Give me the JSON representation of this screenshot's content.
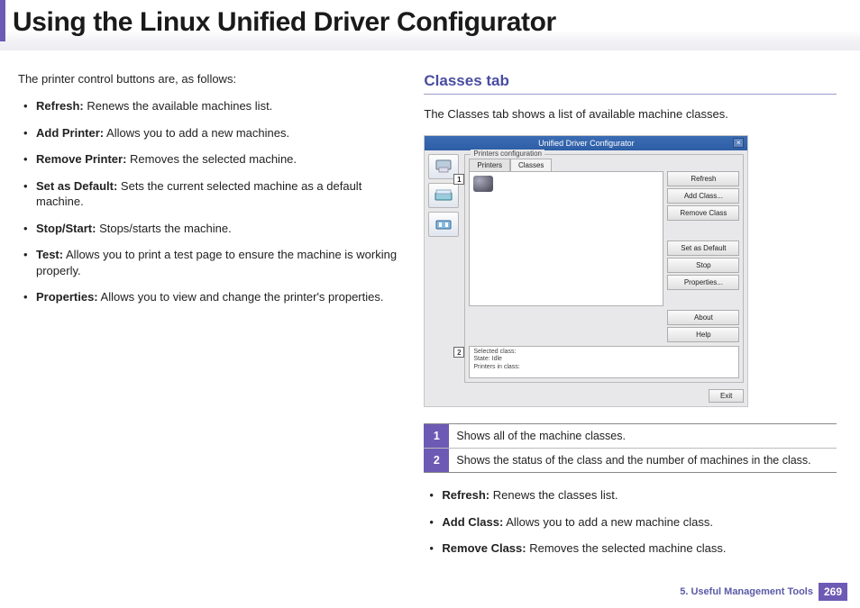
{
  "page_title": "Using the Linux Unified Driver Configurator",
  "left": {
    "intro": "The printer control buttons are, as follows:",
    "items": [
      {
        "term": "Refresh:",
        "text": " Renews the available machines list."
      },
      {
        "term": "Add Printer:",
        "text": " Allows you to add a new machines."
      },
      {
        "term": "Remove Printer:",
        "text": " Removes the selected machine."
      },
      {
        "term": "Set as Default:",
        "text": " Sets the current selected machine as a default machine."
      },
      {
        "term": "Stop/Start:",
        "text": " Stops/starts the machine."
      },
      {
        "term": "Test:",
        "text": " Allows you to print a test page to ensure the machine is working properly."
      },
      {
        "term": "Properties:",
        "text": " Allows you to view and change the printer's properties."
      }
    ]
  },
  "right": {
    "heading": "Classes tab",
    "desc": "The Classes tab shows a list of available machine classes.",
    "screenshot": {
      "title": "Unified Driver Configurator",
      "group_label": "Printers configuration",
      "tab_printers": "Printers",
      "tab_classes": "Classes",
      "buttons": {
        "refresh": "Refresh",
        "add_class": "Add Class...",
        "remove_class": "Remove Class",
        "set_default": "Set as Default",
        "stop": "Stop",
        "properties": "Properties...",
        "about": "About",
        "help": "Help",
        "exit": "Exit"
      },
      "status_lines": {
        "l1": "Selected class:",
        "l2": "State: Idle",
        "l3": "Printers in class:"
      },
      "callout1": "1",
      "callout2": "2"
    },
    "table": {
      "r1_num": "1",
      "r1_text": "Shows all of the machine classes.",
      "r2_num": "2",
      "r2_text": "Shows the status of the class and the number of machines in the class."
    },
    "items": [
      {
        "term": "Refresh:",
        "text": " Renews the classes list."
      },
      {
        "term": "Add Class:",
        "text": " Allows you to add a new machine class."
      },
      {
        "term": "Remove Class:",
        "text": " Removes the selected machine class."
      }
    ]
  },
  "footer": {
    "chapter": "5.  Useful Management Tools",
    "page": "269"
  }
}
